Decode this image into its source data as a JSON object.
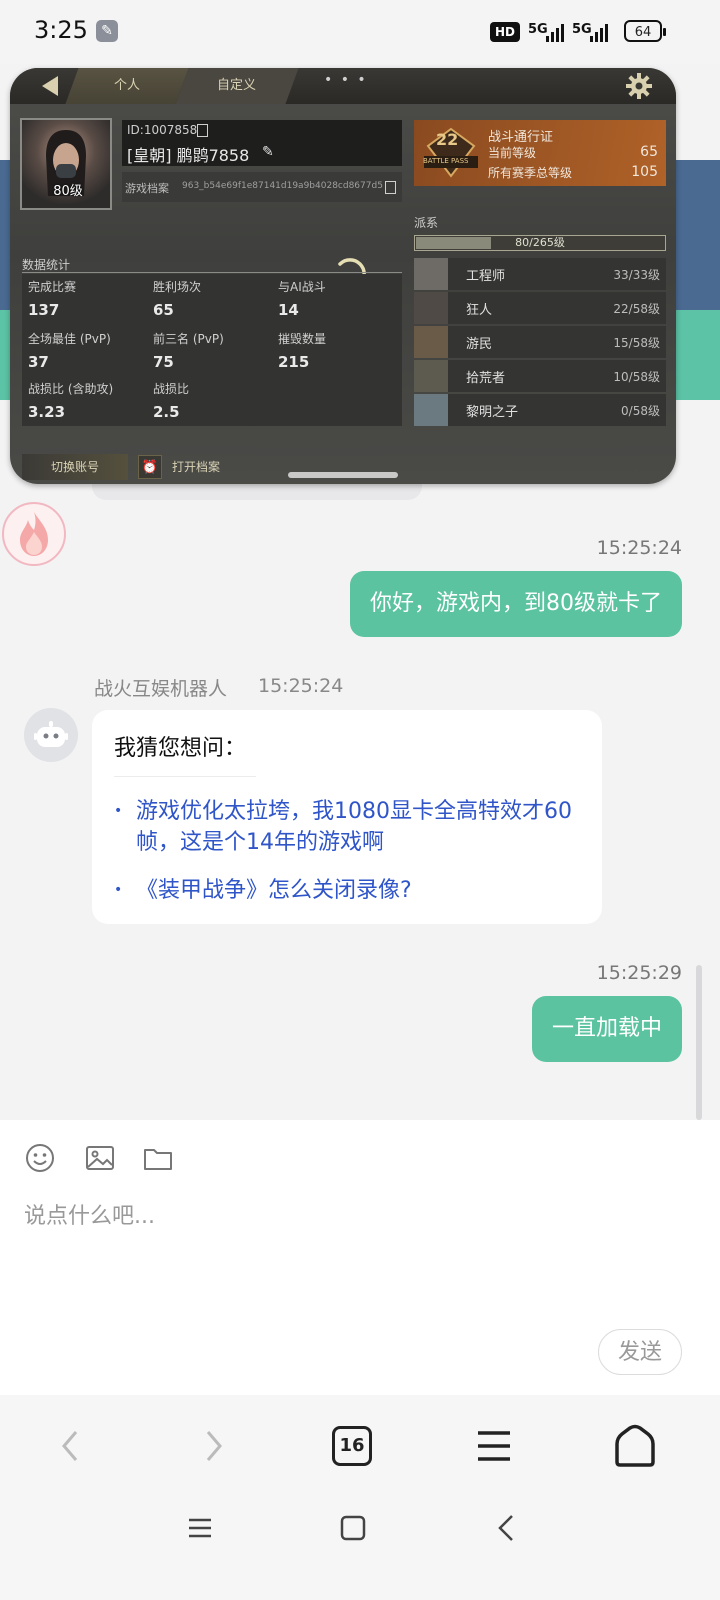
{
  "status_bar": {
    "time": "3:25",
    "hd": "HD",
    "net1": "5G",
    "net2": "5G",
    "battery": "64"
  },
  "game": {
    "tabs": [
      "个人",
      "自定义"
    ],
    "more": "• • •",
    "player": {
      "level": "80级",
      "id": "ID:1007858",
      "name": "[皇朝] 鹏鹍7858",
      "archive_label": "游戏档案",
      "archive_value": "963_b54e69f1e87141d19a9b4028cd8677d5"
    },
    "battle_pass": {
      "title": "战斗通行证",
      "badge": "BATTLE PASS",
      "badge_num": "22",
      "current_label": "当前等级",
      "current_value": "65",
      "total_label": "所有赛季总等级",
      "total_value": "105"
    },
    "stats": {
      "title": "数据统计",
      "items": [
        {
          "label": "完成比赛",
          "value": "137"
        },
        {
          "label": "胜利场次",
          "value": "65"
        },
        {
          "label": "与AI战斗",
          "value": "14"
        },
        {
          "label": "全场最佳 (PvP)",
          "value": "37"
        },
        {
          "label": "前三名 (PvP)",
          "value": "75"
        },
        {
          "label": "摧毁数量",
          "value": "215"
        },
        {
          "label": "战损比 (含助攻)",
          "value": "3.23"
        },
        {
          "label": "战损比",
          "value": "2.5"
        }
      ]
    },
    "factions": {
      "title": "派系",
      "progress_text": "80/265级",
      "progress_fraction": 0.302,
      "items": [
        {
          "name": "工程师",
          "level": "33/33级",
          "color": "#6e6b66"
        },
        {
          "name": "狂人",
          "level": "22/58级",
          "color": "#4f4a45"
        },
        {
          "name": "游民",
          "level": "15/58级",
          "color": "#6a5a48"
        },
        {
          "name": "拾荒者",
          "level": "10/58级",
          "color": "#5d5a50"
        },
        {
          "name": "黎明之子",
          "level": "0/58级",
          "color": "#6b7a80"
        }
      ]
    },
    "switch_account": "切换账号",
    "open_archive": "打开档案"
  },
  "chat": {
    "msg1_time": "15:25:24",
    "msg1_text": "你好，游戏内，到80级就卡了",
    "bot_name": "战火互娱机器人",
    "bot_time": "15:25:24",
    "bot_title": "我猜您想问：",
    "suggestions": [
      "游戏优化太拉垮，我1080显卡全高特效才60帧，这是个14年的游戏啊",
      "《装甲战争》怎么关闭录像?"
    ],
    "msg2_time": "15:25:29",
    "msg2_text": "一直加载中"
  },
  "input": {
    "placeholder": "说点什么吧...",
    "send": "发送"
  },
  "browser": {
    "tab_count": "16"
  }
}
